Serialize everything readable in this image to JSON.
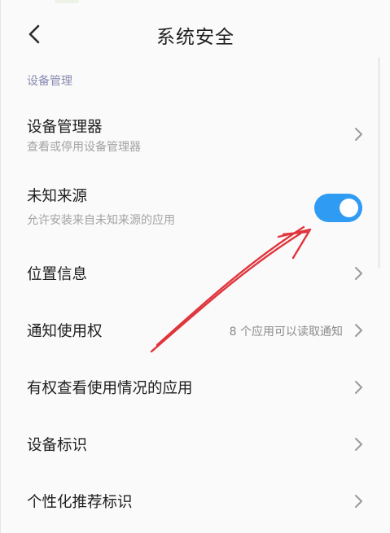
{
  "header": {
    "title": "系统安全",
    "back_icon": "chevron-left-icon"
  },
  "section": {
    "label": "设备管理"
  },
  "rows": [
    {
      "label": "设备管理器",
      "sublabel": "查看或停用设备管理器",
      "control": "chevron"
    },
    {
      "label": "未知来源",
      "sublabel": "允许安装来自未知来源的应用",
      "control": "toggle",
      "toggle_on": true
    },
    {
      "label": "位置信息",
      "control": "chevron"
    },
    {
      "label": "通知使用权",
      "value": "8 个应用可以读取通知",
      "control": "chevron"
    },
    {
      "label": "有权查看使用情况的应用",
      "control": "chevron"
    },
    {
      "label": "设备标识",
      "control": "chevron"
    },
    {
      "label": "个性化推荐标识",
      "control": "chevron"
    }
  ],
  "colors": {
    "accent": "#2f9bf3",
    "annotation_arrow": "#e0353c",
    "section_header": "#8a8ab3"
  }
}
